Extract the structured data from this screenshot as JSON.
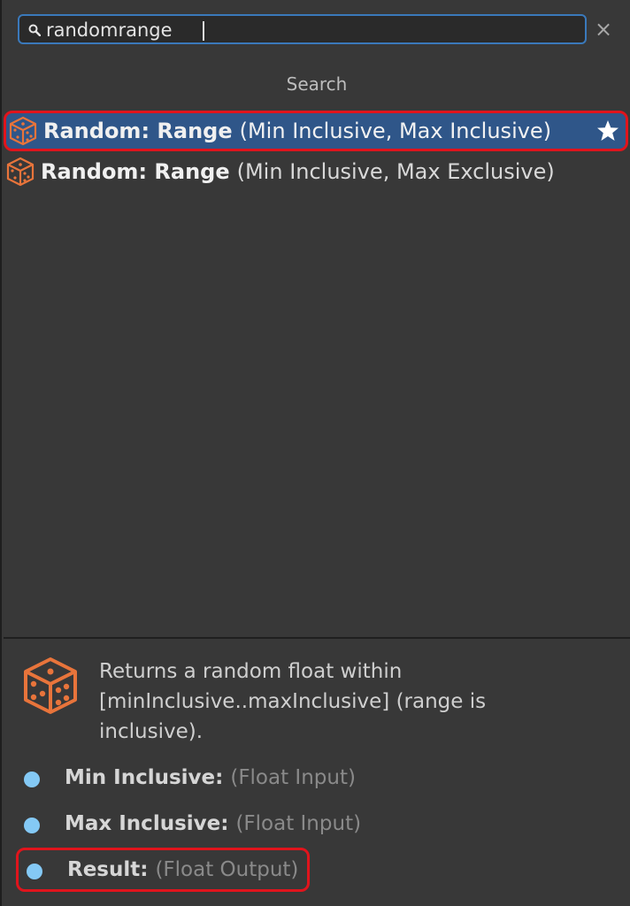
{
  "search": {
    "query": "randomrange",
    "clear_label": "×"
  },
  "section_title": "Search",
  "results": [
    {
      "name": "Random: Range",
      "params": "(Min Inclusive, Max Inclusive)",
      "favorite": true,
      "selected": true,
      "icon": "dice-icon"
    },
    {
      "name": "Random: Range",
      "params": "(Min Inclusive, Max Exclusive)",
      "favorite": false,
      "selected": false,
      "icon": "dice-icon"
    }
  ],
  "details": {
    "icon": "dice-icon",
    "description": "Returns a random float within [minInclusive..maxInclusive] (range is inclusive).",
    "ports": [
      {
        "name": "Min Inclusive:",
        "type": "(Float Input)"
      },
      {
        "name": "Max Inclusive:",
        "type": "(Float Input)"
      },
      {
        "name": "Result:",
        "type": "(Float Output)"
      }
    ]
  },
  "colors": {
    "background": "#383838",
    "selection": "#2f5689",
    "highlight_outline": "#e0141c",
    "port_dot": "#84c9f5",
    "icon_orange": "#e8743b"
  }
}
